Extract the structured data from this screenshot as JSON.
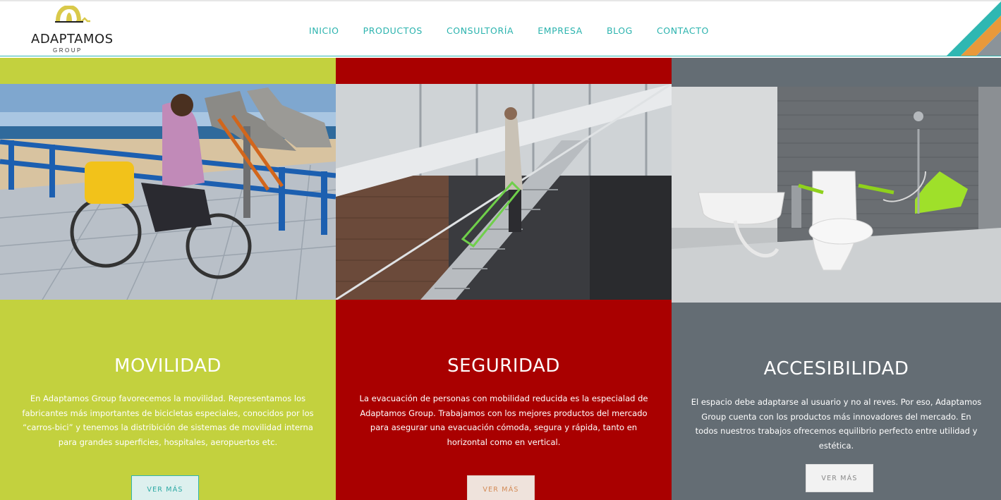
{
  "header": {
    "logo_text": "ADAPTAMOS",
    "logo_sub": "GROUP",
    "nav": [
      {
        "label": "INICIO"
      },
      {
        "label": "PRODUCTOS"
      },
      {
        "label": "CONSULTORÍA"
      },
      {
        "label": "EMPRESA"
      },
      {
        "label": "BLOG"
      },
      {
        "label": "CONTACTO"
      }
    ],
    "colors": {
      "accent": "#2bb3ae",
      "logo_yellow": "#d9c94a",
      "orange": "#e9993a"
    }
  },
  "columns": [
    {
      "title": "MOVILIDAD",
      "text": "En Adaptamos Group favorecemos la movilidad. Representamos los fabricantes más importantes de bicicletas especiales, conocidos por los “carros-bici” y tenemos la distribición de sistemas de movilidad interna para grandes superficies, hospitales, aeropuertos etc.",
      "button": "VER MÁS",
      "bg": "#c3d13e"
    },
    {
      "title": "SEGURIDAD",
      "text": "La evacuación de personas con mobilidad reducida es la especialad de Adaptamos Group. Trabajamos con los mejores productos del mercado para asegurar una evacuación cómoda, segura y rápida, tanto en horizontal como en vertical.",
      "button": "VER MÁS",
      "bg": "#a90000"
    },
    {
      "title": "ACCESIBILIDAD",
      "text": "El espacio debe adaptarse al usuario y no al reves. Por eso, Adaptamos Group cuenta con los productos más innovadores del mercado. En todos nuestros trabajos ofrecemos equilibrio perfecto entre utilidad y estética.",
      "button": "VER MÁS",
      "bg": "#646d74"
    }
  ]
}
